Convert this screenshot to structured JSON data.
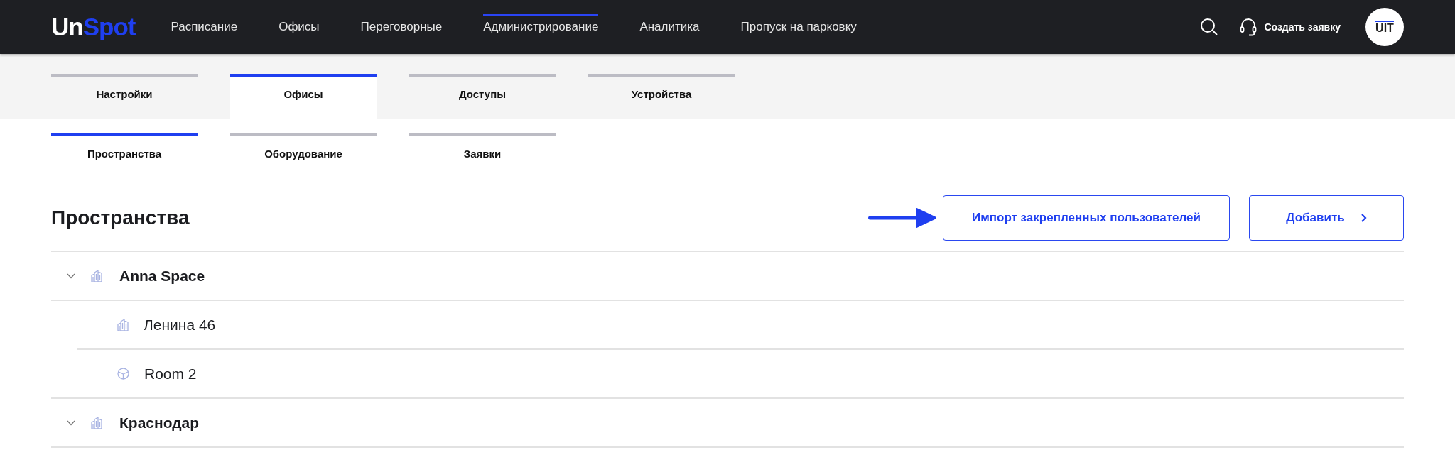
{
  "header": {
    "logo": [
      "Un",
      "Spot"
    ],
    "nav": [
      {
        "label": "Расписание",
        "selected": false
      },
      {
        "label": "Офисы",
        "selected": false
      },
      {
        "label": "Переговорные",
        "selected": false
      },
      {
        "label": "Администрирование",
        "selected": true
      },
      {
        "label": "Аналитика",
        "selected": false
      },
      {
        "label": "Пропуск на парковку",
        "selected": false
      }
    ],
    "support_label": "Создать заявку",
    "avatar": "UIT"
  },
  "tabs": [
    {
      "label": "Настройки",
      "selected": false
    },
    {
      "label": "Офисы",
      "selected": true
    },
    {
      "label": "Доступы",
      "selected": false
    },
    {
      "label": "Устройства",
      "selected": false
    }
  ],
  "subtabs": [
    {
      "label": "Пространства",
      "selected": true
    },
    {
      "label": "Оборудование",
      "selected": false
    },
    {
      "label": "Заявки",
      "selected": false
    }
  ],
  "page_title": "Пространства",
  "buttons": [
    {
      "label": "Импорт закрепленных пользователей",
      "kind": "import"
    },
    {
      "label": "Добавить",
      "kind": "add"
    }
  ],
  "tree": [
    {
      "label": "Anna Space",
      "kind": "building",
      "expanded": true,
      "children": [
        {
          "label": "Ленина 46",
          "kind": "building"
        },
        {
          "label": "Room 2",
          "kind": "room"
        }
      ]
    },
    {
      "label": "Краснодар",
      "kind": "building",
      "expanded": true
    }
  ]
}
